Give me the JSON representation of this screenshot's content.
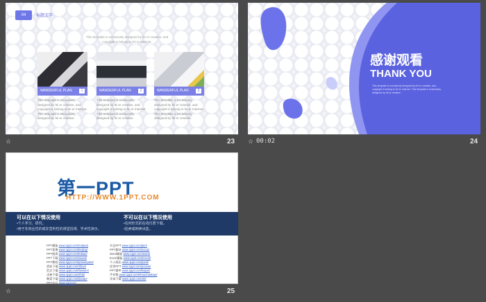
{
  "slide23": {
    "number": "23",
    "badge": "04",
    "title": "标题文字",
    "subtitle": "This template is exclusively designed by fei er creative, and copyright is belong to fei er Internet.",
    "cards": [
      {
        "label": "WANDERFUL  PLAN",
        "num": "1",
        "desc": "This template is exclusively designed by fei er creative, and copyright is belong to fei er Internet. This template is exclusively designed by fei er creative."
      },
      {
        "label": "WANDERFUL  PLAN",
        "num": "2",
        "desc": "This template is exclusively designed by fei er creative, and copyright is belong to fei er Internet. This template is exclusively designed by fei er creative."
      },
      {
        "label": "WANDERFUL  PLAN",
        "num": "3",
        "desc": "This template is exclusively designed by fei er creative, and copyright is belong to fei er Internet. This template is exclusively designed by fei er creative."
      }
    ]
  },
  "slide24": {
    "number": "24",
    "timestamp": "00:02",
    "title_cn": "感谢观看",
    "title_en": "THANK YOU",
    "small": "This template is exclusively designed by fei er creative, and copyright is belong to fei er Internet. This template is exclusively designed by fei er creative."
  },
  "slide25": {
    "number": "25",
    "logo": "第一PPT",
    "url": "HTTP://WWW.1PPT.COM",
    "left_heading": "可以在以下情况使用",
    "left_lines": [
      "•个人学习、研究。",
      "•用于非商业性的或非营利性的课堂授课、学术性演示。"
    ],
    "right_heading": "不可以在以下情况使用",
    "right_lines": [
      "•任何形式的在线付费下载。",
      "•拍卖或倒卖出售。"
    ],
    "links_left": [
      [
        "PPT模板",
        "www.1ppt.com/moban/"
      ],
      [
        "PPT背景",
        "www.1ppt.com/beijing/"
      ],
      [
        "PPT图表",
        "www.1ppt.com/tubiao/"
      ],
      [
        "PPT下载",
        "www.1ppt.com/xiazai/"
      ],
      [
        "PPT教程",
        "www.1ppt.com/powerpoint/"
      ],
      [
        "资料下载",
        "www.1ppt.com/ziliao/"
      ],
      [
        "范文下载",
        "www.1ppt.com/fanwen/"
      ],
      [
        "试卷下载",
        "www.1ppt.com/shiti/"
      ],
      [
        "教案下载",
        "www.1ppt.com/jiaoan/"
      ],
      [
        "PPT论坛",
        "www.1ppt.cn/"
      ]
    ],
    "links_right": [
      [
        "节日PPT",
        "www.1ppt.com/jieri/"
      ],
      [
        "PPT素材",
        "www.1ppt.com/sucai/"
      ],
      [
        "Word模板",
        "www.1ppt.com/word/"
      ],
      [
        "Excel模板",
        "www.1ppt.com/excel/"
      ],
      [
        "个人简历",
        "www.1ppt.com/jianli/"
      ],
      [
        "优秀PPT",
        "www.1ppt.com/youxiu/"
      ],
      [
        "PPT课件",
        "www.1ppt.com/kejian/"
      ],
      [
        "手抄报",
        "www.1ppt.com/shouchaobao/"
      ],
      [
        "字体下载",
        "www.1ppt.com/ziti/"
      ]
    ]
  }
}
